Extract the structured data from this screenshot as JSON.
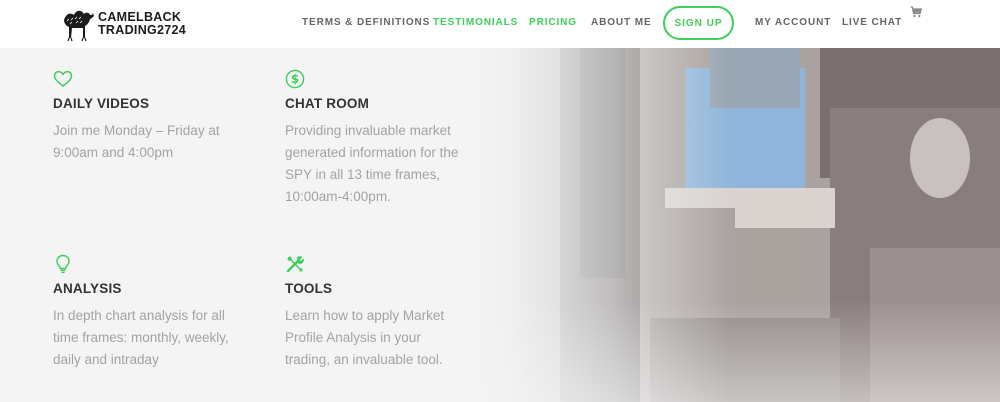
{
  "header": {
    "logo_line1": "CAMELBACK",
    "logo_line2": "TRADING2724",
    "nav": [
      {
        "label": "TERMS & DEFINITIONS",
        "active": false
      },
      {
        "label": "TESTIMONIALS",
        "active": true
      },
      {
        "label": "PRICING",
        "active": true
      },
      {
        "label": "ABOUT ME",
        "active": false
      },
      {
        "label": "SIGN UP",
        "button": true
      },
      {
        "label": "MY ACCOUNT",
        "active": false
      },
      {
        "label": "LIVE CHAT",
        "active": false
      }
    ],
    "cart_icon": "cart-icon"
  },
  "colors": {
    "accent": "#3ccf5a",
    "heading": "#333333",
    "body_text": "#a3a3a3",
    "nav_text": "#666666"
  },
  "features": [
    {
      "icon": "heart-icon",
      "title": "DAILY VIDEOS",
      "text": "Join me Monday – Friday at 9:00am and 4:00pm"
    },
    {
      "icon": "dollar-icon",
      "title": "CHAT ROOM",
      "text": "Providing invaluable market generated information for the SPY in all 13 time frames, 10:00am-4:00pm."
    },
    {
      "icon": "lightbulb-icon",
      "title": "ANALYSIS",
      "text": "In depth chart analysis for all time frames: monthly, weekly, daily and intraday"
    },
    {
      "icon": "tools-icon",
      "title": "TOOLS",
      "text": "Learn how to apply Market Profile Analysis in your trading, an invaluable tool."
    }
  ]
}
